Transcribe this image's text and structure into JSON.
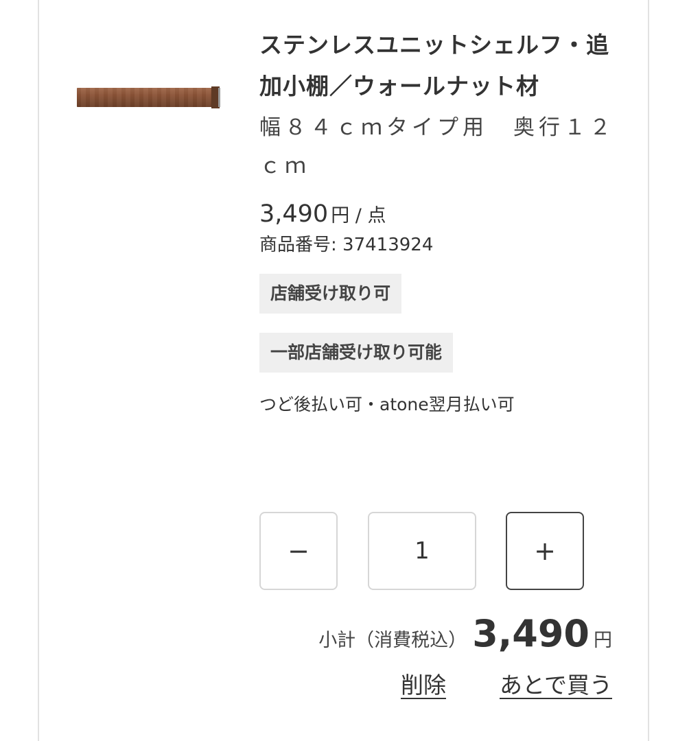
{
  "product": {
    "title": "ステンレスユニットシェルフ・追加小棚／ウォールナット材",
    "subtitle": "幅８４ｃｍタイプ用　奥行１２ｃｍ",
    "price": "3,490",
    "price_unit": "円 / 点",
    "sku_label": "商品番号: 37413924",
    "badges": [
      "店舗受け取り可",
      "一部店舗受け取り可能"
    ],
    "payment": "つど後払い可・atone翌月払い可"
  },
  "quantity": {
    "minus_label": "−",
    "value": "1",
    "plus_label": "+"
  },
  "subtotal": {
    "label": "小計（消費税込）",
    "amount": "3,490",
    "currency": "円"
  },
  "actions": {
    "delete_label": "削除",
    "later_label": "あとで買う"
  },
  "icons": {
    "thumbnail": "walnut-shelf-board-image"
  }
}
